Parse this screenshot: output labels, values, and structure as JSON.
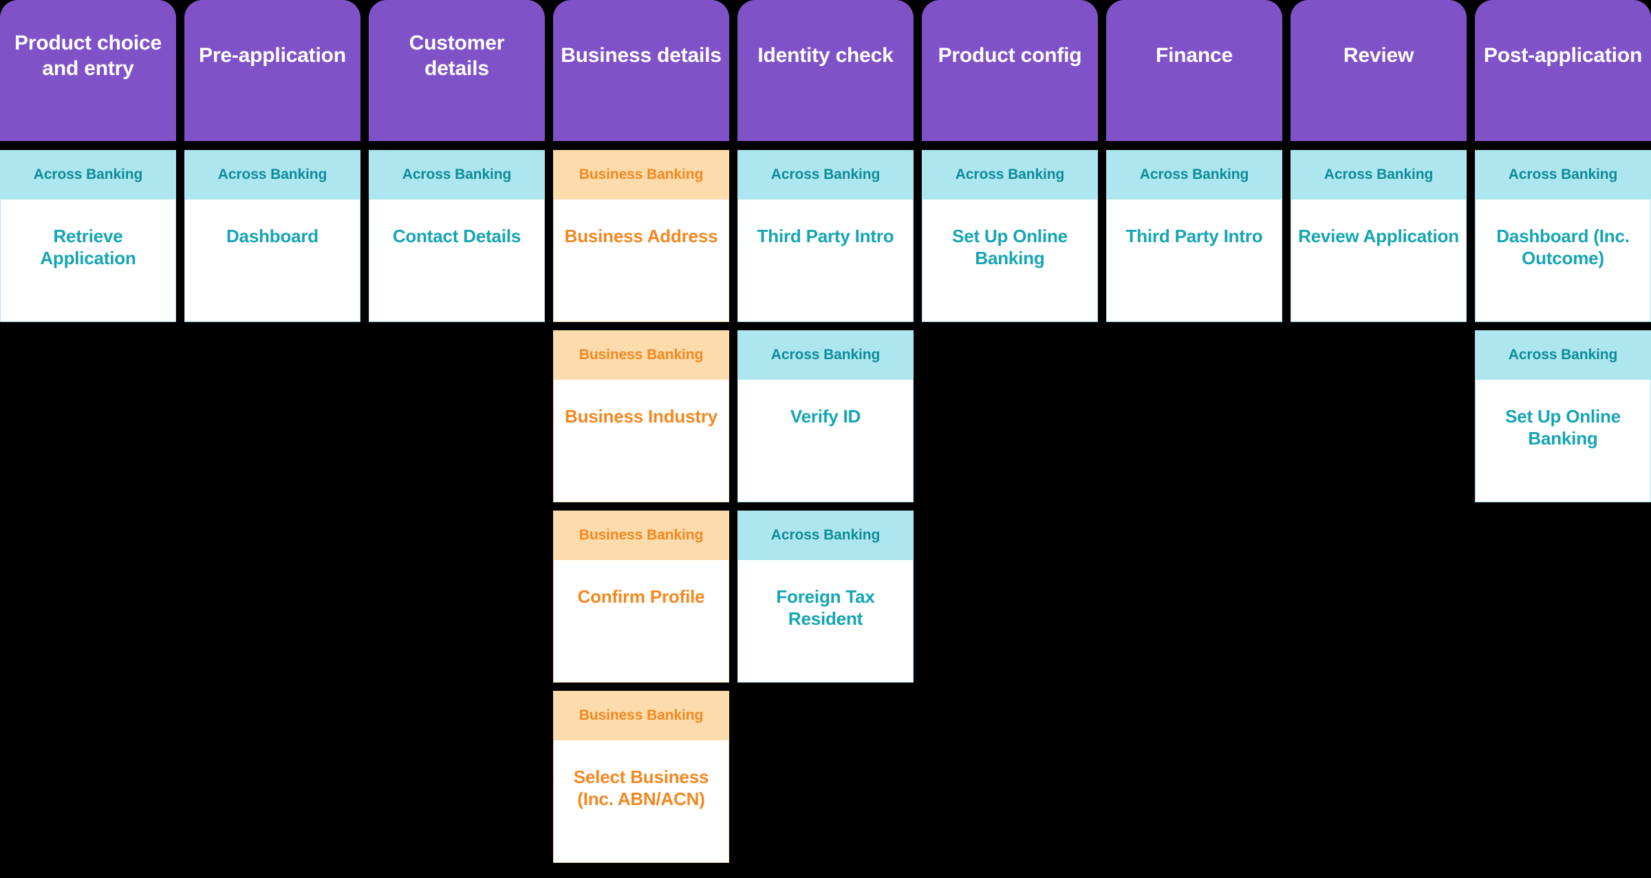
{
  "board": {
    "background_color": "#000000",
    "phase_header_color": "#8052C8",
    "tracks": {
      "across": {
        "label": "Across Banking",
        "band_color": "#AEE6EF",
        "band_text_color": "#0C8C99",
        "body_text_color": "#14A5B4"
      },
      "business": {
        "label": "Business Banking",
        "band_color": "#FCDCAC",
        "band_text_color": "#F5871F",
        "body_text_color": "#F5871F"
      }
    }
  },
  "columns": [
    {
      "phase": "Product choice and entry",
      "cards": [
        {
          "track": "across",
          "track_label": "Across Banking",
          "step": "Retrieve Application"
        }
      ]
    },
    {
      "phase": "Pre-application",
      "cards": [
        {
          "track": "across",
          "track_label": "Across Banking",
          "step": "Dashboard"
        }
      ]
    },
    {
      "phase": "Customer details",
      "cards": [
        {
          "track": "across",
          "track_label": "Across Banking",
          "step": "Contact Details"
        }
      ]
    },
    {
      "phase": "Business details",
      "cards": [
        {
          "track": "business",
          "track_label": "Business Banking",
          "step": "Business Address"
        },
        {
          "track": "business",
          "track_label": "Business Banking",
          "step": "Business Industry"
        },
        {
          "track": "business",
          "track_label": "Business Banking",
          "step": "Confirm Profile"
        },
        {
          "track": "business",
          "track_label": "Business Banking",
          "step": "Select Business (Inc. ABN/ACN)"
        }
      ]
    },
    {
      "phase": "Identity check",
      "cards": [
        {
          "track": "across",
          "track_label": "Across Banking",
          "step": "Third Party Intro"
        },
        {
          "track": "across",
          "track_label": "Across Banking",
          "step": "Verify ID"
        },
        {
          "track": "across",
          "track_label": "Across Banking",
          "step": "Foreign Tax Resident"
        }
      ]
    },
    {
      "phase": "Product config",
      "cards": [
        {
          "track": "across",
          "track_label": "Across Banking",
          "step": "Set Up Online Banking"
        }
      ]
    },
    {
      "phase": "Finance",
      "cards": [
        {
          "track": "across",
          "track_label": "Across Banking",
          "step": "Third Party Intro"
        }
      ]
    },
    {
      "phase": "Review",
      "cards": [
        {
          "track": "across",
          "track_label": "Across Banking",
          "step": "Review Application"
        }
      ]
    },
    {
      "phase": "Post-application",
      "cards": [
        {
          "track": "across",
          "track_label": "Across Banking",
          "step": "Dashboard (Inc. Outcome)"
        },
        {
          "track": "across",
          "track_label": "Across Banking",
          "step": "Set Up Online Banking"
        }
      ]
    }
  ]
}
